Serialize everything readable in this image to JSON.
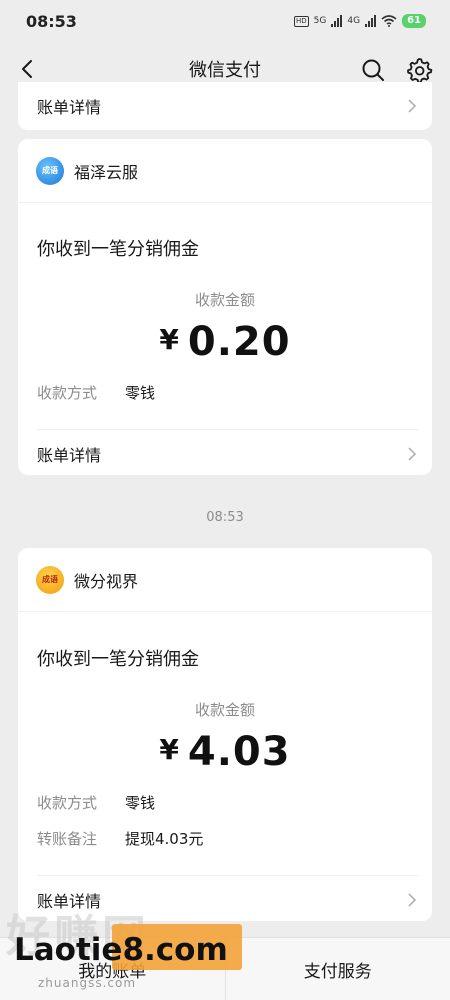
{
  "status": {
    "time": "08:53",
    "hd": "HD",
    "net1": "5G",
    "net2": "4G",
    "battery": "61"
  },
  "nav": {
    "title": "微信支付"
  },
  "top_card": {
    "detail_label": "账单详情"
  },
  "cards": [
    {
      "merchant": "福泽云服",
      "logo_text": "成语",
      "notice": "你收到一笔分销佣金",
      "amount_label": "收款金额",
      "currency": "¥",
      "amount": "0.20",
      "fields": [
        {
          "key": "收款方式",
          "value": "零钱"
        }
      ],
      "detail_label": "账单详情"
    },
    {
      "merchant": "微分视界",
      "logo_text": "成语",
      "notice": "你收到一笔分销佣金",
      "amount_label": "收款金额",
      "currency": "¥",
      "amount": "4.03",
      "fields": [
        {
          "key": "收款方式",
          "value": "零钱"
        },
        {
          "key": "转账备注",
          "value": "提现4.03元"
        }
      ],
      "detail_label": "账单详情"
    }
  ],
  "timestamp": "08:53",
  "bottom": {
    "left_label": "我的账单",
    "right_label": "支付服务"
  },
  "watermark": {
    "ghost": "好赚网",
    "main": "Laotie8.com",
    "url": "zhuangss.com"
  }
}
